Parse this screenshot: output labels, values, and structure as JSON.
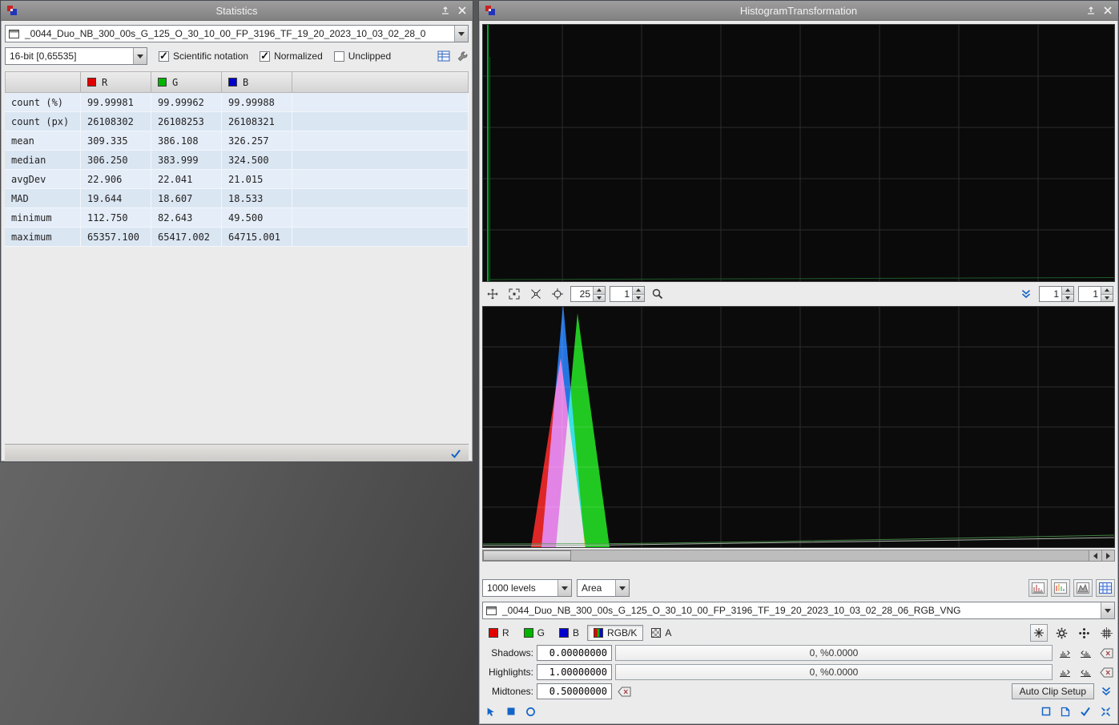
{
  "statistics": {
    "title": "Statistics",
    "view_selector": {
      "value": "_0044_Duo_NB_300_00s_G_125_O_30_10_00_FP_3196_TF_19_20_2023_10_03_02_28_0"
    },
    "format_selector": {
      "value": "16-bit [0,65535]"
    },
    "options": {
      "scientific_notation": {
        "label": "Scientific notation",
        "checked": true
      },
      "normalized": {
        "label": "Normalized",
        "checked": true
      },
      "unclipped": {
        "label": "Unclipped",
        "checked": false
      }
    },
    "table": {
      "columns": [
        "R",
        "G",
        "B"
      ],
      "col_colors": [
        "#e00000",
        "#00b400",
        "#0000cc"
      ],
      "rows": [
        {
          "label": "count (%)",
          "r": "99.99981",
          "g": "99.99962",
          "b": "99.99988"
        },
        {
          "label": "count (px)",
          "r": "26108302",
          "g": "26108253",
          "b": "26108321"
        },
        {
          "label": "mean",
          "r": "309.335",
          "g": "386.108",
          "b": "326.257"
        },
        {
          "label": "median",
          "r": "306.250",
          "g": "383.999",
          "b": "324.500"
        },
        {
          "label": "avgDev",
          "r": "22.906",
          "g": "22.041",
          "b": "21.015"
        },
        {
          "label": "MAD",
          "r": "19.644",
          "g": "18.607",
          "b": "18.533"
        },
        {
          "label": "minimum",
          "r": "112.750",
          "g": "82.643",
          "b": "49.500"
        },
        {
          "label": "maximum",
          "r": "65357.100",
          "g": "65417.002",
          "b": "64715.001"
        }
      ]
    }
  },
  "histogram": {
    "title": "HistogramTransformation",
    "toolbar": {
      "h_zoom": "25",
      "v_zoom": "1",
      "right_h_zoom": "1",
      "right_v_zoom": "1"
    },
    "resolution": "1000 levels",
    "graph_style": "Area",
    "view_selector": {
      "value": "_0044_Duo_NB_300_00s_G_125_O_30_10_00_FP_3196_TF_19_20_2023_10_03_02_28_06_RGB_VNG"
    },
    "channels": {
      "r": "R",
      "g": "G",
      "b": "B",
      "rgbk": "RGB/K",
      "a": "A",
      "selected": "RGB/K"
    },
    "channel_colors": {
      "r": "#e00000",
      "g": "#00b400",
      "b": "#0000cc"
    },
    "params": {
      "shadows": {
        "label": "Shadows:",
        "value": "0.00000000",
        "readout": "0, %0.0000"
      },
      "highlights": {
        "label": "Highlights:",
        "value": "1.00000000",
        "readout": "0, %0.0000"
      },
      "midtones": {
        "label": "Midtones:",
        "value": "0.50000000"
      }
    },
    "auto_clip_button": "Auto Clip Setup"
  }
}
